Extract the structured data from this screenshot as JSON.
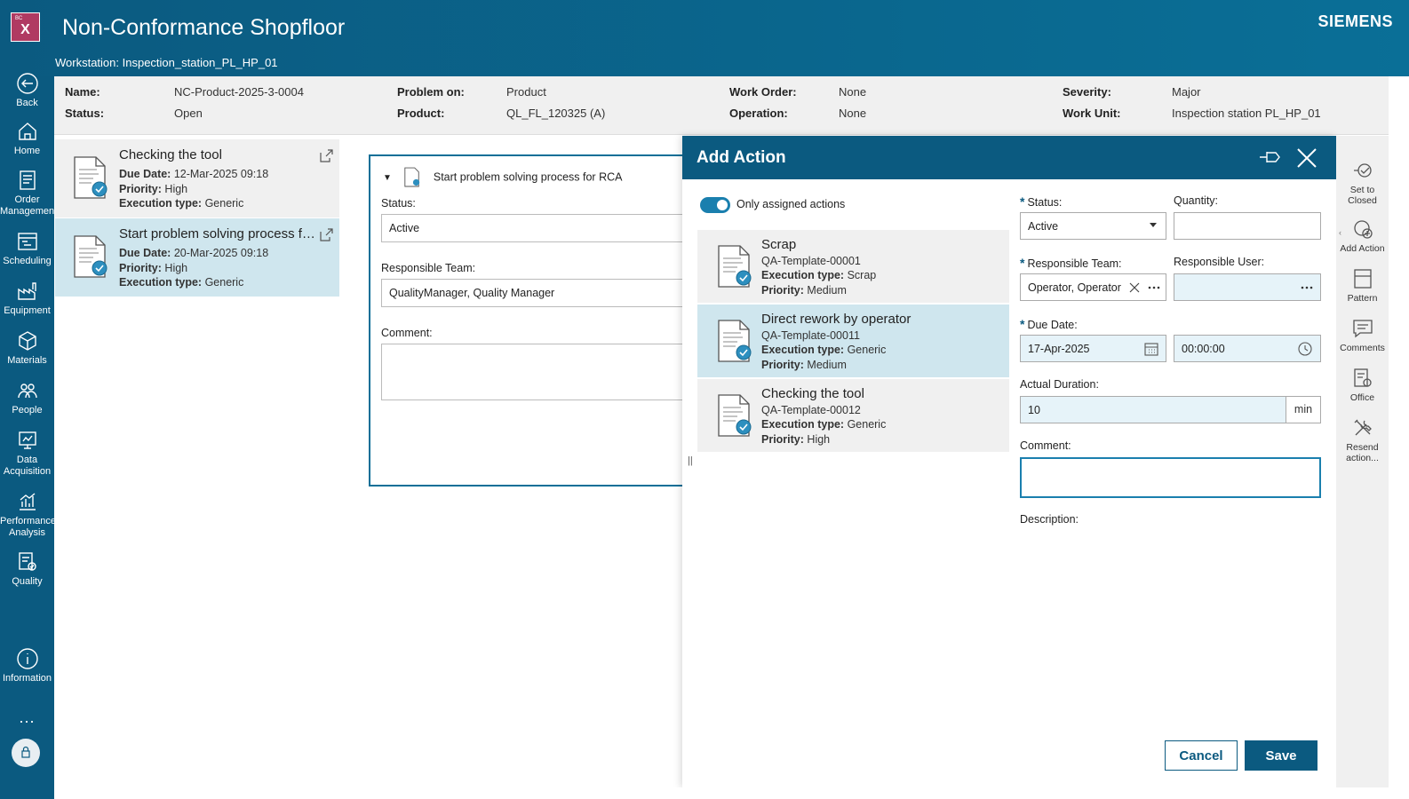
{
  "header": {
    "logo_small": "BC",
    "logo_letter": "X",
    "title": "Non-Conformance Shopfloor",
    "workstation": "Workstation: Inspection_station_PL_HP_01",
    "brand": "SIEMENS"
  },
  "nav": {
    "back": "Back",
    "home": "Home",
    "order_management": "Order Management",
    "scheduling": "Scheduling",
    "equipment": "Equipment",
    "materials": "Materials",
    "people": "People",
    "data_acquisition": "Data Acquisition",
    "performance_analysis": "Performance Analysis",
    "quality": "Quality",
    "information": "Information",
    "more": "..."
  },
  "info": {
    "name_label": "Name:",
    "name_value": "NC-Product-2025-3-0004",
    "status_label": "Status:",
    "status_value": "Open",
    "problem_on_label": "Problem on:",
    "problem_on_value": "Product",
    "product_label": "Product:",
    "product_value": "QL_FL_120325 (A)",
    "work_order_label": "Work Order:",
    "work_order_value": "None",
    "operation_label": "Operation:",
    "operation_value": "None",
    "severity_label": "Severity:",
    "severity_value": "Major",
    "work_unit_label": "Work Unit:",
    "work_unit_value": "Inspection station PL_HP_01"
  },
  "actions_list": [
    {
      "title": "Checking the tool",
      "due_label": "Due Date:",
      "due": "12-Mar-2025 09:18",
      "priority_label": "Priority:",
      "priority": "High",
      "exec_label": "Execution type:",
      "exec": "Generic"
    },
    {
      "title": "Start problem solving process fo...",
      "due_label": "Due Date:",
      "due": "20-Mar-2025 09:18",
      "priority_label": "Priority:",
      "priority": "High",
      "exec_label": "Execution type:",
      "exec": "Generic"
    }
  ],
  "detail": {
    "title": "Start problem solving process for RCA",
    "status_label": "Status:",
    "status_value": "Active",
    "team_label": "Responsible Team:",
    "team_value": "QualityManager, Quality Manager",
    "comment_label": "Comment:"
  },
  "modal": {
    "title": "Add Action",
    "toggle_label": "Only assigned actions",
    "templates": [
      {
        "title": "Scrap",
        "id": "QA-Template-00001",
        "exec_label": "Execution type:",
        "exec": "Scrap",
        "priority_label": "Priority:",
        "priority": "Medium"
      },
      {
        "title": "Direct rework by operator",
        "id": "QA-Template-00011",
        "exec_label": "Execution type:",
        "exec": "Generic",
        "priority_label": "Priority:",
        "priority": "Medium"
      },
      {
        "title": "Checking the tool",
        "id": "QA-Template-00012",
        "exec_label": "Execution type:",
        "exec": "Generic",
        "priority_label": "Priority:",
        "priority": "High"
      }
    ],
    "splitter": "||",
    "form": {
      "required_mark": "*",
      "status_label": "Status:",
      "status_value": "Active",
      "quantity_label": "Quantity:",
      "quantity_value": "",
      "team_label": "Responsible Team:",
      "team_value": "Operator, Operator",
      "user_label": "Responsible User:",
      "user_value": "",
      "due_label": "Due Date:",
      "due_date": "17-Apr-2025",
      "due_time": "00:00:00",
      "duration_label": "Actual Duration:",
      "duration_value": "10",
      "duration_unit": "min",
      "comment_label": "Comment:",
      "description_label": "Description:"
    },
    "cancel": "Cancel",
    "save": "Save"
  },
  "rightbar": {
    "set_closed": "Set to Closed",
    "add_action": "Add Action",
    "pattern": "Pattern",
    "comments": "Comments",
    "office": "Office",
    "resend": "Resend action..."
  },
  "colors": {
    "primary": "#0b5a80",
    "selected": "#cfe6ee",
    "panel": "#f0f0f0"
  }
}
